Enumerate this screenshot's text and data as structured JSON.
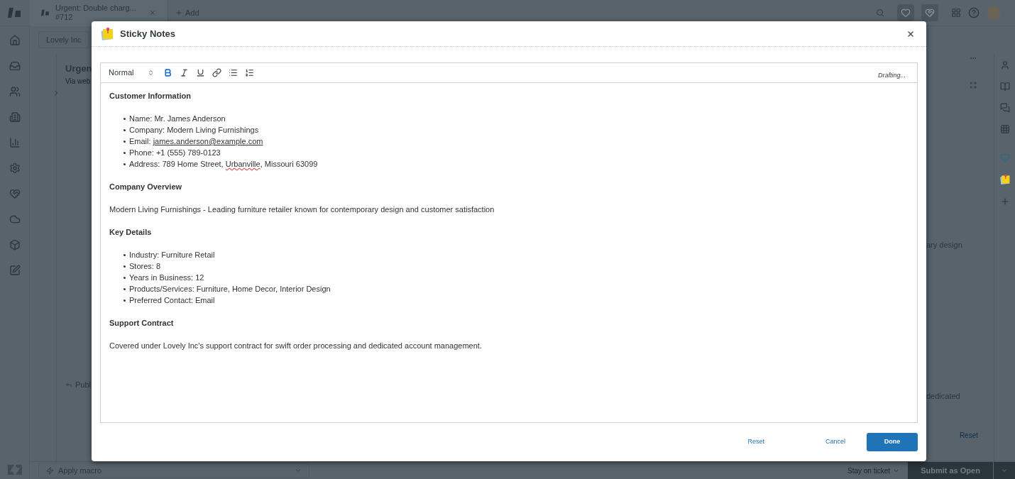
{
  "app_bar": {
    "tabs": [
      {
        "title": "Urgent: Double charg...",
        "subtitle": "#712",
        "selected": true
      }
    ],
    "add_label": "Add"
  },
  "org_tab": "Lovely Inc",
  "ticket": {
    "title": "Urgen",
    "channel": "Via web",
    "reply_mode": "Publ",
    "snippet_1": "ary design",
    "snippet_2": "dedicated",
    "reset_label": "Reset"
  },
  "bottom_bar": {
    "macro": "Apply macro",
    "stay": "Stay on ticket",
    "submit": "Submit as Open"
  },
  "modal": {
    "title": "Sticky Notes",
    "format": "Normal",
    "status": "Drafting...",
    "tools": [
      {
        "kind": "bold",
        "active": true
      },
      {
        "kind": "italic",
        "active": false
      },
      {
        "kind": "underline",
        "active": false
      },
      {
        "kind": "link",
        "active": false
      },
      {
        "kind": "bullets",
        "active": false
      },
      {
        "kind": "numbers",
        "active": false
      }
    ],
    "blocks": [
      {
        "kind": "heading",
        "text": "Customer Information"
      },
      {
        "kind": "list",
        "items": [
          [
            {
              "kind": "plain",
              "text": "Name: Mr. James Anderson"
            }
          ],
          [
            {
              "kind": "plain",
              "text": "Company: Modern Living Furnishings"
            }
          ],
          [
            {
              "kind": "plain",
              "text": "Email: "
            },
            {
              "kind": "link",
              "text": "james.anderson@example.com"
            }
          ],
          [
            {
              "kind": "plain",
              "text": "Phone: +1 (555) 789-0123"
            }
          ],
          [
            {
              "kind": "plain",
              "text": "Address: 789 Home Street, "
            },
            {
              "kind": "misspelled",
              "text": "Urbanville"
            },
            {
              "kind": "plain",
              "text": ", Missouri 63099"
            }
          ]
        ]
      },
      {
        "kind": "heading",
        "text": "Company Overview"
      },
      {
        "kind": "paragraph",
        "text": "Modern Living Furnishings - Leading furniture retailer known for contemporary design and customer satisfaction"
      },
      {
        "kind": "heading",
        "text": "Key Details"
      },
      {
        "kind": "list",
        "items": [
          [
            {
              "kind": "plain",
              "text": "Industry: Furniture Retail"
            }
          ],
          [
            {
              "kind": "plain",
              "text": "Stores: 8"
            }
          ],
          [
            {
              "kind": "plain",
              "text": "Years in Business: 12"
            }
          ],
          [
            {
              "kind": "plain",
              "text": "Products/Services: Furniture, Home Decor, Interior Design"
            }
          ],
          [
            {
              "kind": "plain",
              "text": "Preferred Contact: Email"
            }
          ]
        ]
      },
      {
        "kind": "heading",
        "text": "Support Contract"
      },
      {
        "kind": "paragraph",
        "text": "Covered under Lovely Inc's support contract for swift order processing and dedicated account management."
      }
    ],
    "buttons": [
      {
        "label": "Reset",
        "kind": "link"
      },
      {
        "label": "Cancel",
        "kind": "link"
      },
      {
        "label": "Done",
        "kind": "primary"
      }
    ]
  }
}
